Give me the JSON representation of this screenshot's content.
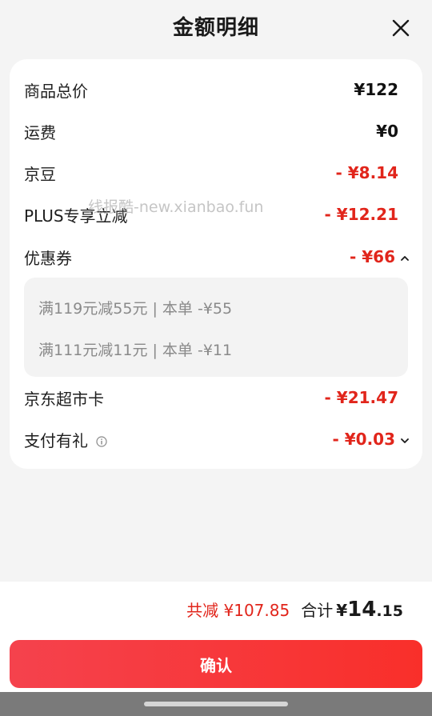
{
  "header": {
    "title": "金额明细"
  },
  "rows": [
    {
      "label": "商品总价",
      "amount": "¥122"
    },
    {
      "label": "运费",
      "amount": "¥0"
    },
    {
      "label": "京豆",
      "amount": "- ¥8.14"
    },
    {
      "label": "PLUS专享立减",
      "amount": "- ¥12.21"
    },
    {
      "label": "优惠券",
      "amount": "- ¥66"
    },
    {
      "label": "京东超市卡",
      "amount": "- ¥21.47"
    },
    {
      "label": "支付有礼",
      "amount": "- ¥0.03"
    }
  ],
  "coupons": [
    "满119元减55元 | 本单 -¥55",
    "满111元减11元 | 本单 -¥11"
  ],
  "watermark": "线报酷-new.xianbao.fun",
  "summary": {
    "saved": "共减 ¥107.85",
    "total_label": "合计",
    "total_currency": "¥",
    "total_int": "14",
    "total_dec": ".15"
  },
  "confirm_label": "确认",
  "colors": {
    "accent_red": "#e1251b",
    "button_start": "#f5424d",
    "button_end": "#f92f2a"
  },
  "icons": {
    "close": "close-icon",
    "coupon_toggle": "chevron-up-icon",
    "payment_toggle": "chevron-down-icon",
    "info": "info-icon"
  }
}
